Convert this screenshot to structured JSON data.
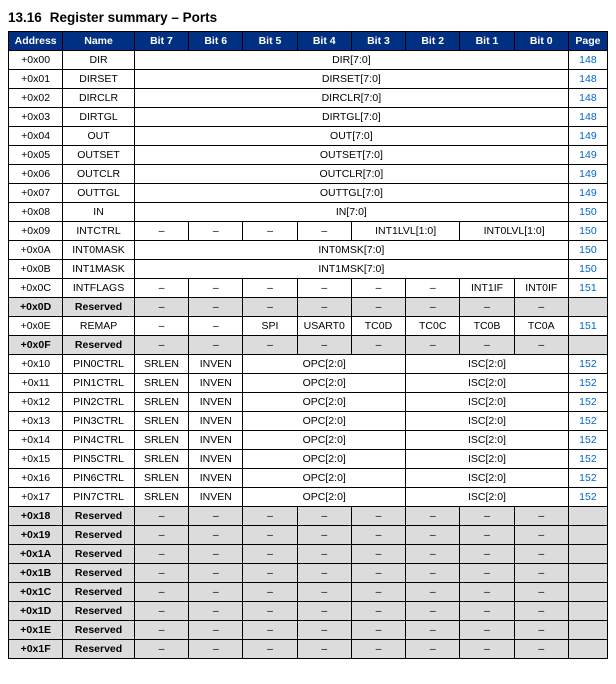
{
  "title": {
    "num": "13.16",
    "text": "Register summary – Ports"
  },
  "headers": {
    "addr": "Address",
    "name": "Name",
    "b7": "Bit 7",
    "b6": "Bit 6",
    "b5": "Bit 5",
    "b4": "Bit 4",
    "b3": "Bit 3",
    "b2": "Bit 2",
    "b1": "Bit 1",
    "b0": "Bit 0",
    "page": "Page"
  },
  "rows": [
    {
      "addr": "+0x00",
      "name": "DIR",
      "cells": [
        {
          "span": 8,
          "t": "DIR[7:0]"
        }
      ],
      "page_link": "148"
    },
    {
      "addr": "+0x01",
      "name": "DIRSET",
      "cells": [
        {
          "span": 8,
          "t": "DIRSET[7:0]"
        }
      ],
      "page_link": "148"
    },
    {
      "addr": "+0x02",
      "name": "DIRCLR",
      "cells": [
        {
          "span": 8,
          "t": "DIRCLR[7:0]"
        }
      ],
      "page_link": "148"
    },
    {
      "addr": "+0x03",
      "name": "DIRTGL",
      "cells": [
        {
          "span": 8,
          "t": "DIRTGL[7:0]"
        }
      ],
      "page_link": "148"
    },
    {
      "addr": "+0x04",
      "name": "OUT",
      "cells": [
        {
          "span": 8,
          "t": "OUT[7:0]"
        }
      ],
      "page_link": "149"
    },
    {
      "addr": "+0x05",
      "name": "OUTSET",
      "cells": [
        {
          "span": 8,
          "t": "OUTSET[7:0]"
        }
      ],
      "page_link": "149"
    },
    {
      "addr": "+0x06",
      "name": "OUTCLR",
      "cells": [
        {
          "span": 8,
          "t": "OUTCLR[7:0]"
        }
      ],
      "page_link": "149"
    },
    {
      "addr": "+0x07",
      "name": "OUTTGL",
      "cells": [
        {
          "span": 8,
          "t": "OUTTGL[7:0]"
        }
      ],
      "page_link": "149"
    },
    {
      "addr": "+0x08",
      "name": "IN",
      "cells": [
        {
          "span": 8,
          "t": "IN[7:0]"
        }
      ],
      "page_link": "150"
    },
    {
      "addr": "+0x09",
      "name": "INTCTRL",
      "cells": [
        {
          "t": "–"
        },
        {
          "t": "–"
        },
        {
          "t": "–"
        },
        {
          "t": "–"
        },
        {
          "span": 2,
          "t": "INT1LVL[1:0]"
        },
        {
          "span": 2,
          "t": "INT0LVL[1:0]"
        }
      ],
      "page_link": "150"
    },
    {
      "addr": "+0x0A",
      "name": "INT0MASK",
      "cells": [
        {
          "span": 8,
          "t": "INT0MSK[7:0]"
        }
      ],
      "page_link": "150"
    },
    {
      "addr": "+0x0B",
      "name": "INT1MASK",
      "cells": [
        {
          "span": 8,
          "t": "INT1MSK[7:0]"
        }
      ],
      "page_link": "150"
    },
    {
      "addr": "+0x0C",
      "name": "INTFLAGS",
      "cells": [
        {
          "t": "–"
        },
        {
          "t": "–"
        },
        {
          "t": "–"
        },
        {
          "t": "–"
        },
        {
          "t": "–"
        },
        {
          "t": "–"
        },
        {
          "t": "INT1IF"
        },
        {
          "t": "INT0IF"
        }
      ],
      "page_link": "151"
    },
    {
      "addr": "+0x0D",
      "name": "Reserved",
      "reserved": true,
      "cells": [
        {
          "t": "–"
        },
        {
          "t": "–"
        },
        {
          "t": "–"
        },
        {
          "t": "–"
        },
        {
          "t": "–"
        },
        {
          "t": "–"
        },
        {
          "t": "–"
        },
        {
          "t": "–"
        }
      ],
      "page": ""
    },
    {
      "addr": "+0x0E",
      "name": "REMAP",
      "cells": [
        {
          "t": "–"
        },
        {
          "t": "–"
        },
        {
          "t": "SPI"
        },
        {
          "t": "USART0"
        },
        {
          "t": "TC0D"
        },
        {
          "t": "TC0C"
        },
        {
          "t": "TC0B"
        },
        {
          "t": "TC0A"
        }
      ],
      "page_link": "151"
    },
    {
      "addr": "+0x0F",
      "name": "Reserved",
      "reserved": true,
      "cells": [
        {
          "t": "–"
        },
        {
          "t": "–"
        },
        {
          "t": "–"
        },
        {
          "t": "–"
        },
        {
          "t": "–"
        },
        {
          "t": "–"
        },
        {
          "t": "–"
        },
        {
          "t": "–"
        }
      ],
      "page": ""
    },
    {
      "addr": "+0x10",
      "name": "PIN0CTRL",
      "cells": [
        {
          "t": "SRLEN"
        },
        {
          "t": "INVEN"
        },
        {
          "span": 3,
          "t": "OPC[2:0]"
        },
        {
          "span": 3,
          "t": "ISC[2:0]"
        }
      ],
      "page_link": "152"
    },
    {
      "addr": "+0x11",
      "name": "PIN1CTRL",
      "cells": [
        {
          "t": "SRLEN"
        },
        {
          "t": "INVEN"
        },
        {
          "span": 3,
          "t": "OPC[2:0]"
        },
        {
          "span": 3,
          "t": "ISC[2:0]"
        }
      ],
      "page_link": "152"
    },
    {
      "addr": "+0x12",
      "name": "PIN2CTRL",
      "cells": [
        {
          "t": "SRLEN"
        },
        {
          "t": "INVEN"
        },
        {
          "span": 3,
          "t": "OPC[2:0]"
        },
        {
          "span": 3,
          "t": "ISC[2:0]"
        }
      ],
      "page_link": "152"
    },
    {
      "addr": "+0x13",
      "name": "PIN3CTRL",
      "cells": [
        {
          "t": "SRLEN"
        },
        {
          "t": "INVEN"
        },
        {
          "span": 3,
          "t": "OPC[2:0]"
        },
        {
          "span": 3,
          "t": "ISC[2:0]"
        }
      ],
      "page_link": "152"
    },
    {
      "addr": "+0x14",
      "name": "PIN4CTRL",
      "cells": [
        {
          "t": "SRLEN"
        },
        {
          "t": "INVEN"
        },
        {
          "span": 3,
          "t": "OPC[2:0]"
        },
        {
          "span": 3,
          "t": "ISC[2:0]"
        }
      ],
      "page_link": "152"
    },
    {
      "addr": "+0x15",
      "name": "PIN5CTRL",
      "cells": [
        {
          "t": "SRLEN"
        },
        {
          "t": "INVEN"
        },
        {
          "span": 3,
          "t": "OPC[2:0]"
        },
        {
          "span": 3,
          "t": "ISC[2:0]"
        }
      ],
      "page_link": "152"
    },
    {
      "addr": "+0x16",
      "name": "PIN6CTRL",
      "cells": [
        {
          "t": "SRLEN"
        },
        {
          "t": "INVEN"
        },
        {
          "span": 3,
          "t": "OPC[2:0]"
        },
        {
          "span": 3,
          "t": "ISC[2:0]"
        }
      ],
      "page_link": "152"
    },
    {
      "addr": "+0x17",
      "name": "PIN7CTRL",
      "cells": [
        {
          "t": "SRLEN"
        },
        {
          "t": "INVEN"
        },
        {
          "span": 3,
          "t": "OPC[2:0]"
        },
        {
          "span": 3,
          "t": "ISC[2:0]"
        }
      ],
      "page_link": "152"
    },
    {
      "addr": "+0x18",
      "name": "Reserved",
      "reserved": true,
      "cells": [
        {
          "t": "–"
        },
        {
          "t": "–"
        },
        {
          "t": "–"
        },
        {
          "t": "–"
        },
        {
          "t": "–"
        },
        {
          "t": "–"
        },
        {
          "t": "–"
        },
        {
          "t": "–"
        }
      ],
      "page": ""
    },
    {
      "addr": "+0x19",
      "name": "Reserved",
      "reserved": true,
      "cells": [
        {
          "t": "–"
        },
        {
          "t": "–"
        },
        {
          "t": "–"
        },
        {
          "t": "–"
        },
        {
          "t": "–"
        },
        {
          "t": "–"
        },
        {
          "t": "–"
        },
        {
          "t": "–"
        }
      ],
      "page": ""
    },
    {
      "addr": "+0x1A",
      "name": "Reserved",
      "reserved": true,
      "cells": [
        {
          "t": "–"
        },
        {
          "t": "–"
        },
        {
          "t": "–"
        },
        {
          "t": "–"
        },
        {
          "t": "–"
        },
        {
          "t": "–"
        },
        {
          "t": "–"
        },
        {
          "t": "–"
        }
      ],
      "page": ""
    },
    {
      "addr": "+0x1B",
      "name": "Reserved",
      "reserved": true,
      "cells": [
        {
          "t": "–"
        },
        {
          "t": "–"
        },
        {
          "t": "–"
        },
        {
          "t": "–"
        },
        {
          "t": "–"
        },
        {
          "t": "–"
        },
        {
          "t": "–"
        },
        {
          "t": "–"
        }
      ],
      "page": ""
    },
    {
      "addr": "+0x1C",
      "name": "Reserved",
      "reserved": true,
      "cells": [
        {
          "t": "–"
        },
        {
          "t": "–"
        },
        {
          "t": "–"
        },
        {
          "t": "–"
        },
        {
          "t": "–"
        },
        {
          "t": "–"
        },
        {
          "t": "–"
        },
        {
          "t": "–"
        }
      ],
      "page": ""
    },
    {
      "addr": "+0x1D",
      "name": "Reserved",
      "reserved": true,
      "cells": [
        {
          "t": "–"
        },
        {
          "t": "–"
        },
        {
          "t": "–"
        },
        {
          "t": "–"
        },
        {
          "t": "–"
        },
        {
          "t": "–"
        },
        {
          "t": "–"
        },
        {
          "t": "–"
        }
      ],
      "page": ""
    },
    {
      "addr": "+0x1E",
      "name": "Reserved",
      "reserved": true,
      "cells": [
        {
          "t": "–"
        },
        {
          "t": "–"
        },
        {
          "t": "–"
        },
        {
          "t": "–"
        },
        {
          "t": "–"
        },
        {
          "t": "–"
        },
        {
          "t": "–"
        },
        {
          "t": "–"
        }
      ],
      "page": ""
    },
    {
      "addr": "+0x1F",
      "name": "Reserved",
      "reserved": true,
      "cells": [
        {
          "t": "–"
        },
        {
          "t": "–"
        },
        {
          "t": "–"
        },
        {
          "t": "–"
        },
        {
          "t": "–"
        },
        {
          "t": "–"
        },
        {
          "t": "–"
        },
        {
          "t": "–"
        }
      ],
      "page": ""
    }
  ]
}
